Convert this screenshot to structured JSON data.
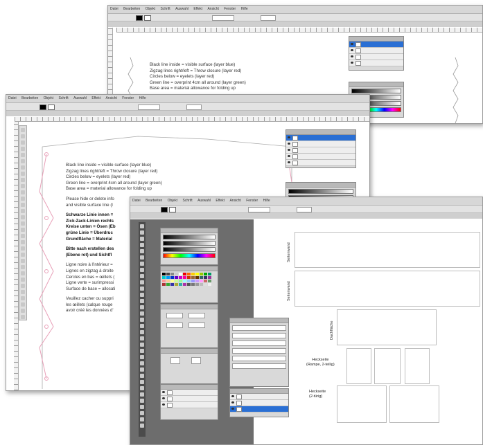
{
  "menu_items": [
    "Datei",
    "Bearbeiten",
    "Objekt",
    "Schrift",
    "Auswahl",
    "Effekt",
    "Ansicht",
    "Fenster",
    "Hilfe"
  ],
  "document_text": {
    "en_lines": [
      "Black line inside = visible surface (layer blue)",
      "Zigzag lines right/left = Throw closure (layer red)",
      "Circles below = eyelets (layer red)",
      "Green line = overprint 4cm all around (layer green)",
      "Base area = material allowance for folding up"
    ],
    "en_lines_back": [
      "Black line inside = visible surface (layer blue)",
      "Zigzag lines right/left = Throw closure (layer red)",
      "Circles below = eyelets (layer red)",
      "Green line = overprint 4cm all around (layer green)",
      "Base area = material allowance for folding up"
    ],
    "en_note": [
      "Please hide or delete info",
      "and visible surface line (l"
    ],
    "de_lines": [
      "Schwarze Linie innen =",
      "Zick-Zack-Linien rechts",
      "Kreise unten = Ösen (Eb",
      "grüne Linie = Überdruc",
      "Grundfläche = Material"
    ],
    "de_note": [
      "Bitte nach erstellen des",
      "(Ebene rot) und Sichtfl"
    ],
    "fr_lines": [
      "Ligne noire à l'intérieur =",
      "Lignes en zigzag à droite",
      "Cercles en bas = œillets (",
      "Ligne verte = surimpressi",
      "Surface de base = allocati"
    ],
    "fr_note": [
      "Veuillez cacher ou suppri",
      "les œillets (calque rouge",
      "avoir créé les données d'"
    ]
  },
  "parts": {
    "labels": [
      "Seitenwand",
      "Seitenwand",
      "Dachfläche",
      "Heckseite (Rampe, 2-teilig)",
      "Heckseite (2-türig)"
    ],
    "labels_short": [
      "Seitenwand",
      "Seitenwand",
      "Dachfläche"
    ],
    "heck_rampe": [
      "Heckseite",
      "(Rampe, 2-teilig)"
    ],
    "heck_tuerig": [
      "Heckseite",
      "(2-türig)"
    ]
  },
  "colors": {
    "selection_blue": "#2a6fd4",
    "zigzag_pink": "#e8a0b8",
    "app_gray": "#d7d7d7",
    "panel_gray": "#d9d9d9"
  },
  "icons": [
    "eye-icon",
    "layer-thumbnail-icon",
    "tool-icon"
  ]
}
